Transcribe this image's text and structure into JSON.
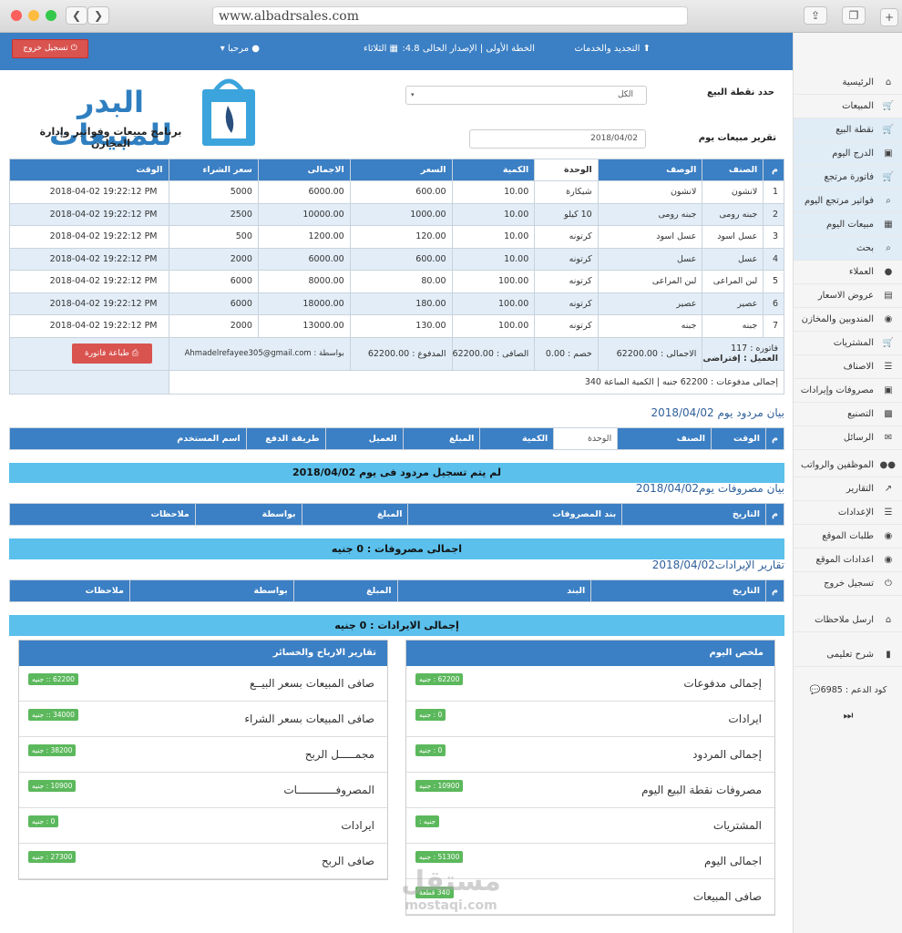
{
  "browser": {
    "url": "www.albadrsales.com",
    "back": "❮",
    "forward": "❯"
  },
  "topbar": {
    "version": "الخطة الأولى | الإصدار الحالى 4.8:",
    "renew": "التجديد والخدمات",
    "day": "الثلاثاء",
    "welcome": "مرحبا",
    "logout": "تسجيل خروج"
  },
  "logo": {
    "title": "البدر للمبيعات",
    "subtitle": "برنامج مبيعات وفواتير وإدارة المخازن"
  },
  "filters": {
    "pos_label": "حدد نقطة البيع",
    "pos_value": "الكل",
    "report_label": "تقرير مبيعات يوم",
    "report_date": "2018/04/02"
  },
  "sales_table": {
    "headers": [
      "م",
      "الصنف",
      "الوصف",
      "الوحدة",
      "الكمية",
      "السعر",
      "الاجمالى",
      "سعر الشراء",
      "الوقت"
    ],
    "rows": [
      [
        "1",
        "لانشون",
        "لانشون",
        "شيكارة",
        "10.00",
        "600.00",
        "6000.00",
        "5000",
        "2018-04-02 19:22:12 PM"
      ],
      [
        "2",
        "جبنه رومى",
        "جبنه رومى",
        "10 كيلو",
        "10.00",
        "1000.00",
        "10000.00",
        "2500",
        "2018-04-02 19:22:12 PM"
      ],
      [
        "3",
        "عسل اسود",
        "عسل اسود",
        "كرتونه",
        "10.00",
        "120.00",
        "1200.00",
        "500",
        "2018-04-02 19:22:12 PM"
      ],
      [
        "4",
        "عسل",
        "عسل",
        "كرتونه",
        "10.00",
        "600.00",
        "6000.00",
        "2000",
        "2018-04-02 19:22:12 PM"
      ],
      [
        "5",
        "لبن المراعى",
        "لبن المراعى",
        "كرتونه",
        "100.00",
        "80.00",
        "8000.00",
        "6000",
        "2018-04-02 19:22:12 PM"
      ],
      [
        "6",
        "عصير",
        "عصير",
        "كرتونه",
        "100.00",
        "180.00",
        "18000.00",
        "6000",
        "2018-04-02 19:22:12 PM"
      ],
      [
        "7",
        "جبنه",
        "جبنه",
        "كرتونه",
        "100.00",
        "130.00",
        "13000.00",
        "2000",
        "2018-04-02 19:22:12 PM"
      ]
    ],
    "summary": {
      "invoice": "فاتوره : 117",
      "client": "العميل : إفتراضى",
      "total": "الاجمالى : 62200.00",
      "discount": "خصم : 0.00",
      "net": "الصافى : 62200.00",
      "paid": "المدفوع : 62200.00",
      "by": "بواسطة : Ahmadelrefayee305@gmail.com",
      "print": "طباعة فاتورة"
    },
    "footer": "إجمالى مدفوعات : 62200 جنيه | الكمية المباعة 340"
  },
  "returns": {
    "title": "بيان مردود يوم 2018/04/02",
    "headers": [
      "م",
      "الوقت",
      "الصنف",
      "الوحدة",
      "الكمية",
      "المبلغ",
      "العميل",
      "طريقة الدفع",
      "اسم المستخدم"
    ],
    "empty": "لم يتم تسجيل مردود فى يوم 2018/04/02"
  },
  "expenses": {
    "title": "بيان مصروفات يوم2018/04/02",
    "headers": [
      "م",
      "التاريخ",
      "بند المصروفات",
      "المبلغ",
      "بواسطة",
      "ملاحظات"
    ],
    "total": "اجمالى مصروفات : 0 جنيه"
  },
  "revenues": {
    "title": "تقارير الإيرادات2018/04/02",
    "headers": [
      "م",
      "التاريخ",
      "البند",
      "المبلغ",
      "بواسطة",
      "ملاحظات"
    ],
    "total": "إجمالى الايرادات : 0 جنيه"
  },
  "day_summary": {
    "title": "ملخص اليوم",
    "rows": [
      {
        "label": "إجمالى مدفوعات",
        "badge": "62200 : جنيه"
      },
      {
        "label": "ايرادات",
        "badge": "0 : جنيه"
      },
      {
        "label": "إجمالى المردود",
        "badge": "0 : جنيه"
      },
      {
        "label": "مصروفات نقطة البيع اليوم",
        "badge": "10900 : جنيه"
      },
      {
        "label": "المشتريات",
        "badge": "جنيه :"
      },
      {
        "label": "اجمالى اليوم",
        "badge": "51300 : جنيه"
      },
      {
        "label": "صافى المبيعات",
        "badge": "340 قطعة"
      }
    ]
  },
  "profit": {
    "title": "تقارير الارباح والخسائر",
    "rows": [
      {
        "label": "صافى المبيعات بسعر البيــع",
        "badge": "62200 :: جنيه"
      },
      {
        "label": "صافى المبيعات بسعر الشراء",
        "badge": "34000 :: جنيه"
      },
      {
        "label": "مجمـــــل الربح",
        "badge": "38200 : جنيه"
      },
      {
        "label": "المصروفــــــــــــات",
        "badge": "10900 : جنيه"
      },
      {
        "label": "ايرادات",
        "badge": "0 : جنيه"
      },
      {
        "label": "صافى الربح",
        "badge": "27300 : جنيه"
      }
    ]
  },
  "sidebar": {
    "items": [
      {
        "label": "الرئيسية",
        "icon": "home-icon",
        "glyph": "⌂",
        "hl": false
      },
      {
        "label": "المبيعات",
        "icon": "cart-icon",
        "glyph": "🛒",
        "hl": false
      },
      {
        "label": "نقطة البيع",
        "icon": "cart-icon",
        "glyph": "🛒",
        "hl": true
      },
      {
        "label": "الدرج اليوم",
        "icon": "cash-icon",
        "glyph": "▣",
        "hl": true
      },
      {
        "label": "فاتورة مرتجع",
        "icon": "cart-icon",
        "glyph": "🛒",
        "hl": true
      },
      {
        "label": "فواتير مرتجع اليوم",
        "icon": "search-icon",
        "glyph": "⌕",
        "hl": true
      },
      {
        "label": "مبيعات اليوم",
        "icon": "calendar-icon",
        "glyph": "▦",
        "hl": true
      },
      {
        "label": "بحث",
        "icon": "search-icon",
        "glyph": "⌕",
        "hl": true
      },
      {
        "label": "العملاء",
        "icon": "user-icon",
        "glyph": "●",
        "hl": false
      },
      {
        "label": "عروض الاسعار",
        "icon": "list-icon",
        "glyph": "▤",
        "hl": false
      },
      {
        "label": "المندوبين والمخازن",
        "icon": "globe-icon",
        "glyph": "◉",
        "hl": false
      },
      {
        "label": "المشتريات",
        "icon": "cart-icon",
        "glyph": "🛒",
        "hl": false
      },
      {
        "label": "الاصناف",
        "icon": "list-icon",
        "glyph": "☰",
        "hl": false
      },
      {
        "label": "مصروفات وإيرادات",
        "icon": "money-icon",
        "glyph": "▣",
        "hl": false
      },
      {
        "label": "التصنيع",
        "icon": "factory-icon",
        "glyph": "▩",
        "hl": false
      },
      {
        "label": "الرسائل",
        "icon": "message-icon",
        "glyph": "✉",
        "hl": false
      },
      {
        "label": "الموظفين والرواتب",
        "icon": "users-icon",
        "glyph": "●●",
        "hl": false
      },
      {
        "label": "التقارير",
        "icon": "chart-icon",
        "glyph": "↗",
        "hl": false
      },
      {
        "label": "الإعدادات",
        "icon": "settings-icon",
        "glyph": "☰",
        "hl": false
      },
      {
        "label": "طلبات الموقع",
        "icon": "globe-icon",
        "glyph": "◉",
        "hl": false
      },
      {
        "label": "اعدادات الموقع",
        "icon": "globe-icon",
        "glyph": "◉",
        "hl": false
      },
      {
        "label": "تسجيل خروج",
        "icon": "power-icon",
        "glyph": "⏻",
        "hl": false
      },
      {
        "label": "ارسل ملاحظات",
        "icon": "home-icon",
        "glyph": "⌂",
        "hl": false
      },
      {
        "label": "شرح تعليمى",
        "icon": "book-icon",
        "glyph": "▮",
        "hl": false
      }
    ],
    "support": "كود الدعم : 6985",
    "collapse": "⏭"
  },
  "watermark": {
    "ar": "مستقل",
    "en": "mostaqi.com"
  }
}
